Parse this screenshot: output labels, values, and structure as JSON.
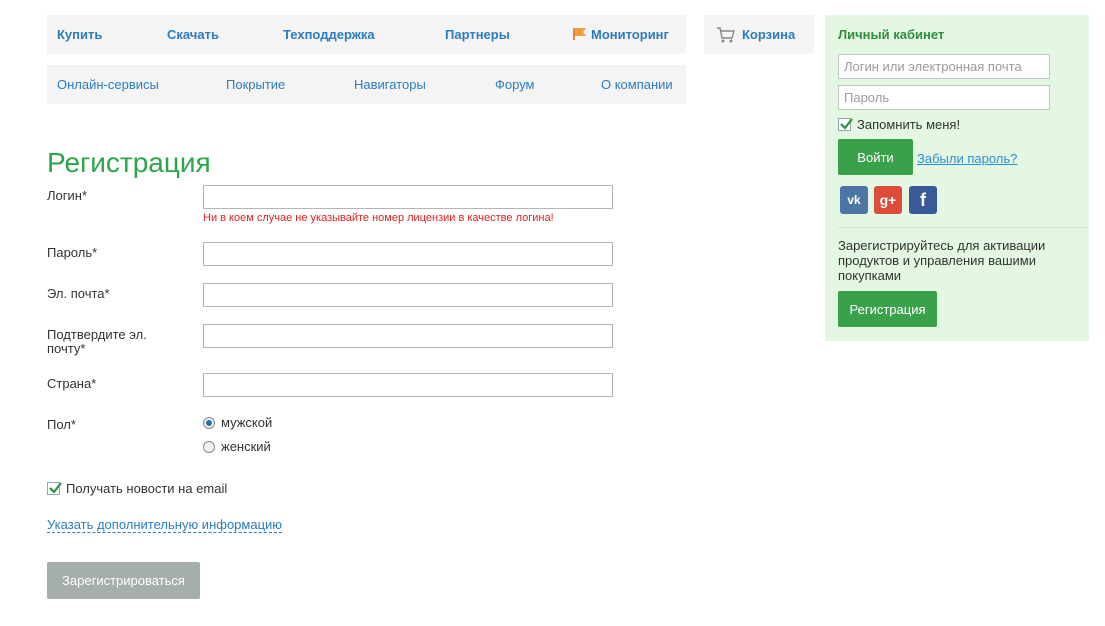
{
  "top_nav": {
    "items": [
      "Купить",
      "Скачать",
      "Техподдержка",
      "Партнеры",
      "Мониторинг"
    ],
    "cart_label": "Корзина"
  },
  "sub_nav": {
    "items": [
      "Онлайн-сервисы",
      "Покрытие",
      "Навигаторы",
      "Форум",
      "О компании"
    ]
  },
  "account_panel": {
    "title": "Личный кабинет",
    "login_placeholder": "Логин или электронная почта",
    "password_placeholder": "Пароль",
    "remember_label": "Запомнить меня!",
    "remember_checked": true,
    "login_button": "Войти",
    "forgot_link": "Забыли пароль?",
    "social": [
      {
        "name": "vk-icon",
        "glyph": "vk"
      },
      {
        "name": "google-plus-icon",
        "glyph": "g+"
      },
      {
        "name": "facebook-icon",
        "glyph": "f"
      }
    ],
    "register_text": "Зарегистрируйтесь для активации продуктов и управления вашими покупками",
    "register_button": "Регистрация"
  },
  "form": {
    "title": "Регистрация",
    "login_label": "Логин*",
    "login_warning": "Ни в коем случае не указывайте номер лицензии в качестве логина!",
    "password_label": "Пароль*",
    "email_label": "Эл. почта*",
    "confirm_email_label_line1": "Подтвердите эл.",
    "confirm_email_label_line2": "почту*",
    "country_label": "Страна*",
    "gender_label": "Пол*",
    "gender_options": [
      "мужской",
      "женский"
    ],
    "gender_selected": "мужской",
    "newsletter_label": "Получать новости на email",
    "newsletter_checked": true,
    "extra_info_link": "Указать дополнительную информацию",
    "submit_button": "Зарегистрироваться"
  },
  "colors": {
    "accent_green": "#3aa04a",
    "title_green": "#2ea54a",
    "link_blue": "#2c7cc2",
    "panel_bg": "#e3f7e2",
    "warning_red": "#e02020"
  }
}
